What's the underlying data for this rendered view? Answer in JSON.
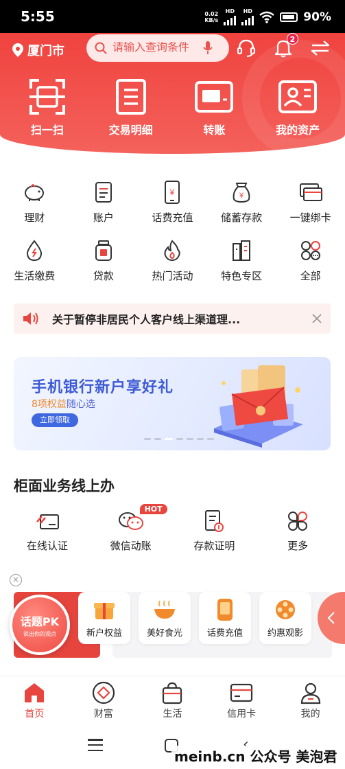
{
  "status_bar": {
    "time": "5:55",
    "net_speed_value": "0.02",
    "net_speed_unit": "KB/s",
    "network_1": "HD",
    "network_2": "HD",
    "battery": "90%"
  },
  "header": {
    "location": "厦门市",
    "search_placeholder": "请输入查询条件",
    "notification_count": "2"
  },
  "quick_actions": [
    {
      "label": "扫一扫",
      "icon": "scan-icon"
    },
    {
      "label": "交易明细",
      "icon": "document-icon"
    },
    {
      "label": "转账",
      "icon": "card-transfer-icon"
    },
    {
      "label": "我的资产",
      "icon": "profile-card-icon"
    }
  ],
  "services": [
    {
      "label": "理财",
      "icon": "piggy-bank-icon"
    },
    {
      "label": "账户",
      "icon": "account-doc-icon"
    },
    {
      "label": "话费充值",
      "icon": "phone-yen-icon"
    },
    {
      "label": "储蓄存款",
      "icon": "money-bag-icon"
    },
    {
      "label": "一键绑卡",
      "icon": "bind-card-icon"
    },
    {
      "label": "生活缴费",
      "icon": "water-drop-icon"
    },
    {
      "label": "贷款",
      "icon": "loan-jar-icon"
    },
    {
      "label": "热门活动",
      "icon": "flame-icon"
    },
    {
      "label": "特色专区",
      "icon": "building-icon"
    },
    {
      "label": "全部",
      "icon": "all-apps-icon"
    }
  ],
  "notice": {
    "text": "关于暂停非居民个人客户线上渠道理..."
  },
  "banner": {
    "title": "手机银行新户享好礼",
    "subtitle_highlight": "8项权益",
    "subtitle_rest": "随心选",
    "button": "立即领取"
  },
  "counter_section": {
    "title": "柜面业务线上办"
  },
  "counter_items": [
    {
      "label": "在线认证",
      "icon": "online-verify-icon"
    },
    {
      "label": "微信动账",
      "icon": "wechat-icon",
      "badge": "HOT"
    },
    {
      "label": "存款证明",
      "icon": "deposit-cert-icon"
    },
    {
      "label": "更多",
      "icon": "more-apps-icon"
    }
  ],
  "floating": {
    "pk_title": "话题PK",
    "pk_sub": "说出你的观点"
  },
  "chips": [
    {
      "label": "新户权益",
      "icon": "gift-icon"
    },
    {
      "label": "美好食光",
      "icon": "food-bowl-icon"
    },
    {
      "label": "话费充值",
      "icon": "phone-icon"
    },
    {
      "label": "约惠观影",
      "icon": "film-reel-icon"
    }
  ],
  "tabbar": [
    {
      "label": "首页",
      "icon": "home-icon",
      "active": true
    },
    {
      "label": "财富",
      "icon": "wealth-icon"
    },
    {
      "label": "生活",
      "icon": "shopping-bag-icon"
    },
    {
      "label": "信用卡",
      "icon": "credit-card-icon"
    },
    {
      "label": "我的",
      "icon": "user-icon"
    }
  ],
  "watermark": "meinb.cn 公众号 美泡君",
  "colors": {
    "brand_red": "#f0433f",
    "banner_blue": "#3e5bd6",
    "accent_orange": "#f08a2d"
  }
}
